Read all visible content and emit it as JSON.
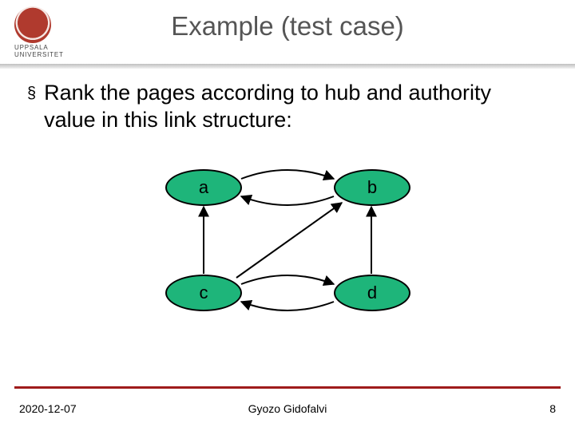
{
  "header": {
    "title": "Example (test case)",
    "logo_org_line1": "UPPSALA",
    "logo_org_line2": "UNIVERSITET"
  },
  "body": {
    "bullet_mark": "§",
    "bullet_text": "Rank the pages according to hub and authority value in this link structure:"
  },
  "graph": {
    "nodes": {
      "a": "a",
      "b": "b",
      "c": "c",
      "d": "d"
    },
    "edges": [
      {
        "from": "a",
        "to": "b"
      },
      {
        "from": "b",
        "to": "a"
      },
      {
        "from": "c",
        "to": "a"
      },
      {
        "from": "c",
        "to": "b"
      },
      {
        "from": "c",
        "to": "d"
      },
      {
        "from": "d",
        "to": "b"
      },
      {
        "from": "d",
        "to": "c"
      }
    ]
  },
  "footer": {
    "date": "2020-12-07",
    "author": "Gyozo Gidofalvi",
    "page": "8"
  }
}
